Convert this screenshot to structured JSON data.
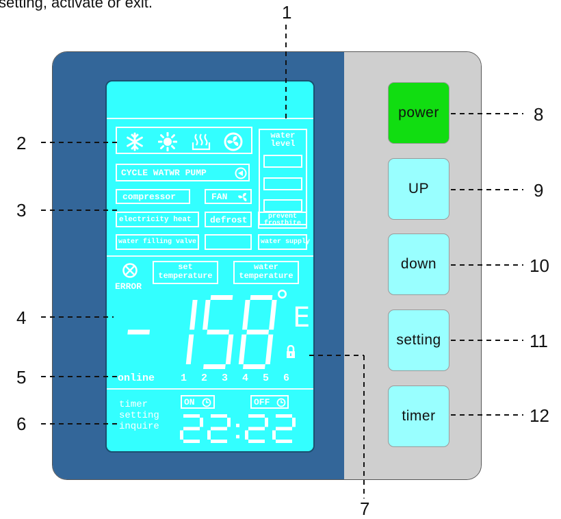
{
  "caption": "setting, activate or exit.",
  "colors": {
    "panel_blue": "#336699",
    "lcd_cyan": "#33ffff",
    "power_green": "#11dd11",
    "button_cyan": "#99ffff",
    "panel_grey": "#cfcfcf"
  },
  "lcd": {
    "mode_icons": [
      "snowflake-icon",
      "sun-icon",
      "heater-icon",
      "fan-icon"
    ],
    "water_level_label_1": "water",
    "water_level_label_2": "level",
    "cycle_pump_label": "CYCLE WATWR PUMP",
    "compressor_label": "compressor",
    "fan_label": "FAN",
    "electricity_heat_label": "electricity heat",
    "defrost_label": "defrost",
    "prevent_label_1": "prevent",
    "prevent_label_2": "frostbite",
    "water_filling_valve_label": "water filling valve",
    "water_supply_label": "water supply",
    "error_label": "ERROR",
    "set_temp_label_1": "set",
    "set_temp_label_2": "temperature",
    "water_temp_label_1": "water",
    "water_temp_label_2": "temperature",
    "main_display": "-158",
    "degree_symbol": "°",
    "unit_letter": "E",
    "online_label": "online",
    "online_numbers": [
      "1",
      "2",
      "3",
      "4",
      "5",
      "6"
    ],
    "timer_label": "timer",
    "setting_label": "setting",
    "inquire_label": "inquire",
    "on_label": "ON",
    "off_label": "OFF",
    "clock_display": "22:22"
  },
  "buttons": {
    "power": "power",
    "up": "UP",
    "down": "down",
    "setting": "setting",
    "timer": "timer"
  },
  "callouts": {
    "c1": "1",
    "c2": "2",
    "c3": "3",
    "c4": "4",
    "c5": "5",
    "c6": "6",
    "c7": "7",
    "c8": "8",
    "c9": "9",
    "c10": "10",
    "c11": "11",
    "c12": "12"
  }
}
